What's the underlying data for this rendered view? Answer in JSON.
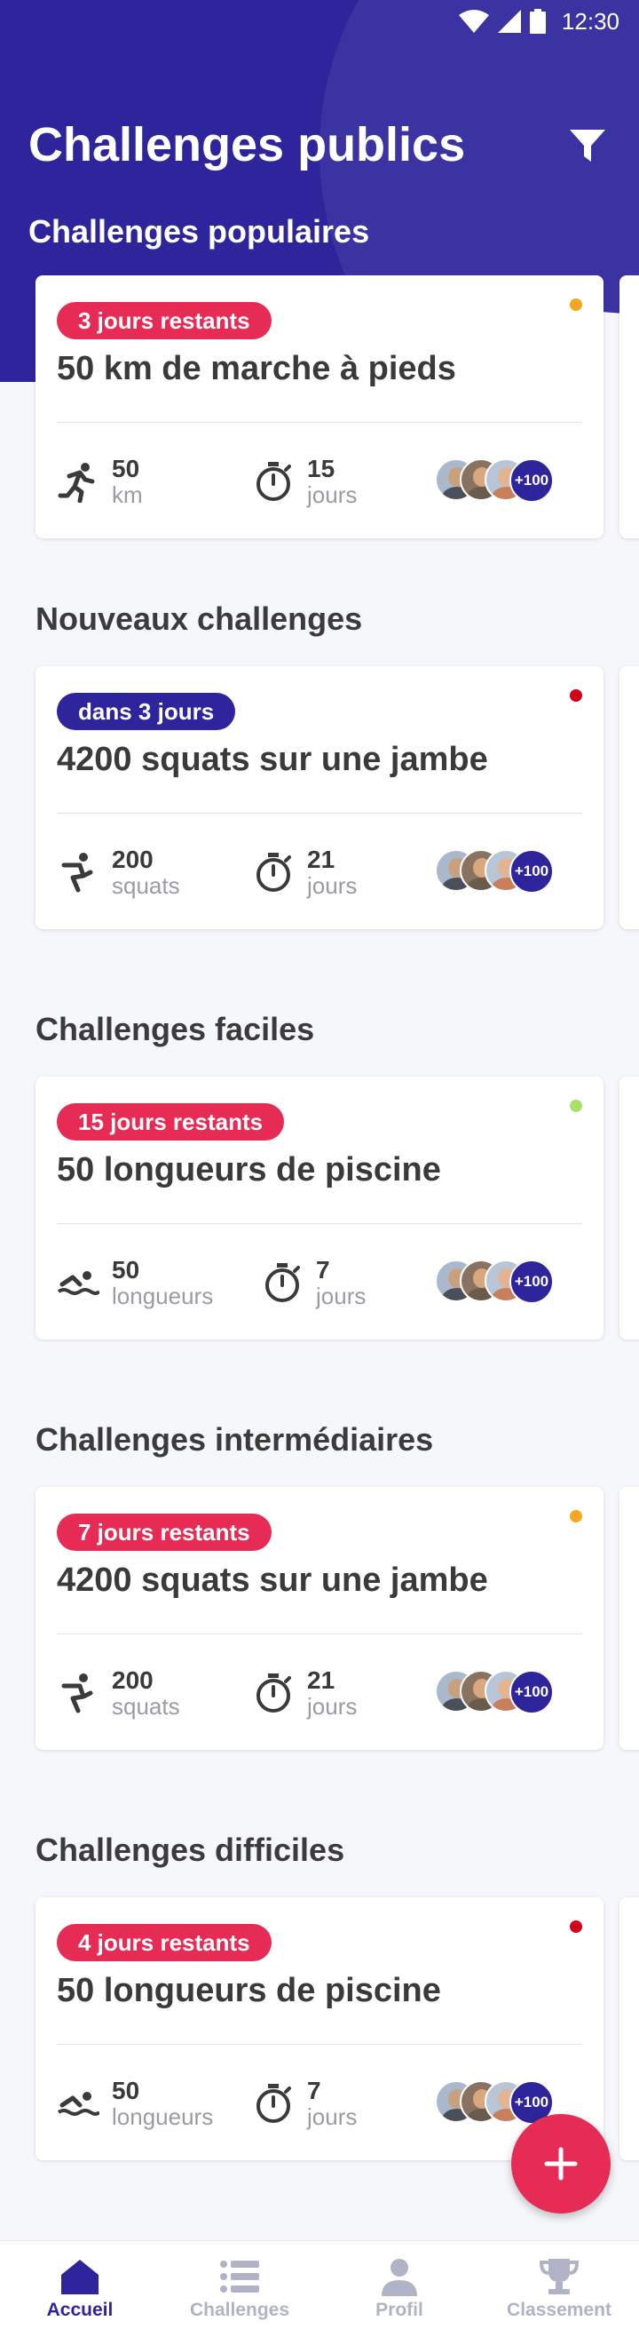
{
  "status_bar": {
    "time": "12:30"
  },
  "header": {
    "title": "Challenges publics",
    "section": "Challenges populaires"
  },
  "sections": [
    {
      "title": "Nouveaux challenges"
    },
    {
      "title": "Challenges faciles"
    },
    {
      "title": "Challenges intermédiaires"
    },
    {
      "title": "Challenges difficiles"
    }
  ],
  "cards": [
    {
      "badge": "3 jours restants",
      "badge_color": "#e62b55",
      "dot_color": "#f5a623",
      "title": "50 km de marche à pieds",
      "activity_icon": "running-icon",
      "stat_value": "50",
      "stat_unit": "km",
      "duration_value": "15",
      "duration_unit": "jours",
      "participants_more": "+100"
    },
    {
      "badge": "dans 3 jours",
      "badge_color": "#2e249b",
      "dot_color": "#d0021b",
      "title": "4200 squats sur une jambe",
      "activity_icon": "squat-icon",
      "stat_value": "200",
      "stat_unit": "squats",
      "duration_value": "21",
      "duration_unit": "jours",
      "participants_more": "+100"
    },
    {
      "badge": "15 jours restants",
      "badge_color": "#e62b55",
      "dot_color": "#a8e06a",
      "title": "50 longueurs de piscine",
      "activity_icon": "swimming-icon",
      "stat_value": "50",
      "stat_unit": "longueurs",
      "duration_value": "7",
      "duration_unit": "jours",
      "participants_more": "+100"
    },
    {
      "badge": "7 jours restants",
      "badge_color": "#e62b55",
      "dot_color": "#f5a623",
      "title": "4200 squats sur une jambe",
      "activity_icon": "squat-icon",
      "stat_value": "200",
      "stat_unit": "squats",
      "duration_value": "21",
      "duration_unit": "jours",
      "participants_more": "+100"
    },
    {
      "badge": "4 jours restants",
      "badge_color": "#e62b55",
      "dot_color": "#d0021b",
      "title": "50 longueurs de piscine",
      "activity_icon": "swimming-icon",
      "stat_value": "50",
      "stat_unit": "longueurs",
      "duration_value": "7",
      "duration_unit": "jours",
      "participants_more": "+100"
    }
  ],
  "nav": [
    {
      "label": "Accueil",
      "icon": "home-icon",
      "active": true
    },
    {
      "label": "Challenges",
      "icon": "list-icon",
      "active": false
    },
    {
      "label": "Profil",
      "icon": "profile-icon",
      "active": false
    },
    {
      "label": "Classement",
      "icon": "trophy-icon",
      "active": false
    }
  ],
  "colors": {
    "primary": "#2e249b",
    "accent": "#e62b55"
  }
}
